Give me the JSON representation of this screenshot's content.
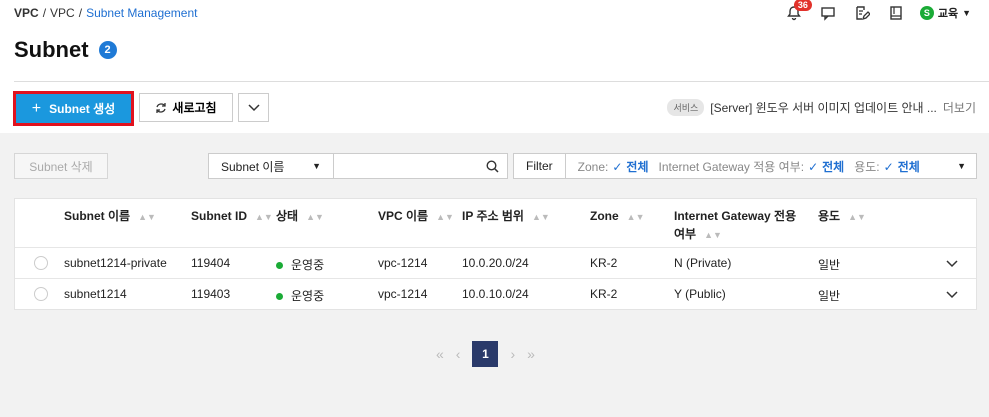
{
  "breadcrumb": {
    "root": "VPC",
    "sep1": "/",
    "mid": "VPC",
    "sep2": "/",
    "current": "Subnet Management"
  },
  "header": {
    "notifications_count": "36",
    "user_initial": "S",
    "user_name": "교육"
  },
  "page": {
    "title": "Subnet",
    "count": "2"
  },
  "toolbar": {
    "create_label": "Subnet 생성",
    "refresh_label": "새로고침"
  },
  "notice": {
    "tag": "서비스",
    "text": "[Server] 윈도우 서버 이미지 업데이트 안내 ...",
    "more": "더보기"
  },
  "filter": {
    "delete_label": "Subnet 삭제",
    "search_field": "Subnet 이름",
    "search_value": "",
    "filter_label": "Filter",
    "zone_label": "Zone:",
    "zone_value": "전체",
    "igw_label": "Internet Gateway 적용 여부:",
    "igw_value": "전체",
    "usage_label": "용도:",
    "usage_value": "전체"
  },
  "table": {
    "headers": [
      "Subnet 이름",
      "Subnet ID",
      "상태",
      "VPC 이름",
      "IP 주소 범위",
      "Zone",
      "Internet Gateway 전용",
      "여부",
      "용도"
    ],
    "rows": [
      {
        "name": "subnet1214-private",
        "id": "119404",
        "status": "운영중",
        "vpc": "vpc-1214",
        "ip": "10.0.20.0/24",
        "zone": "KR-2",
        "igw": "N (Private)",
        "usage": "일반"
      },
      {
        "name": "subnet1214",
        "id": "119403",
        "status": "운영중",
        "vpc": "vpc-1214",
        "ip": "10.0.10.0/24",
        "zone": "KR-2",
        "igw": "Y (Public)",
        "usage": "일반"
      }
    ]
  },
  "pager": {
    "current": "1"
  },
  "colors": {
    "accent": "#1b98de",
    "highlight": "#e1121e",
    "status_running": "#1aab36",
    "link": "#1f6fd1"
  }
}
